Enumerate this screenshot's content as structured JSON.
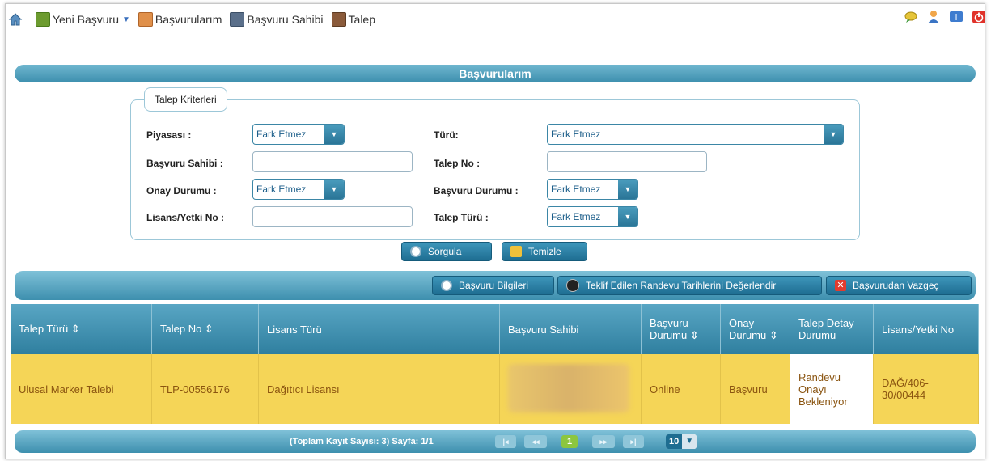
{
  "nav": {
    "new_application": "Yeni Başvuru",
    "my_applications": "Başvurularım",
    "applicant": "Başvuru Sahibi",
    "request": "Talep"
  },
  "header_title": "Başvurularım",
  "criteria": {
    "legend": "Talep Kriterleri",
    "market_label": "Piyasası :",
    "market_value": "Fark Etmez",
    "type_label": "Türü:",
    "type_value": "Fark Etmez",
    "applicant_label": "Başvuru Sahibi :",
    "request_no_label": "Talep No :",
    "approval_status_label": "Onay Durumu :",
    "approval_status_value": "Fark Etmez",
    "application_status_label": "Başvuru Durumu :",
    "application_status_value": "Fark Etmez",
    "license_no_label": "Lisans/Yetki No :",
    "request_type_label": "Talep Türü :",
    "request_type_value": "Fark Etmez"
  },
  "buttons": {
    "query": "Sorgula",
    "clear": "Temizle",
    "app_info": "Başvuru Bilgileri",
    "evaluate_dates": "Teklif Edilen Randevu Tarihlerini Değerlendir",
    "withdraw": "Başvurudan Vazgeç"
  },
  "table": {
    "headers": [
      "Talep Türü ⇕",
      "Talep No ⇕",
      "Lisans Türü",
      "Başvuru Sahibi",
      "Başvuru Durumu ⇕",
      "Onay Durumu ⇕",
      "Talep Detay Durumu",
      "Lisans/Yetki No"
    ],
    "row": {
      "request_type": "Ulusal Marker Talebi",
      "request_no": "TLP-00556176",
      "license_type": "Dağıtıcı Lisansı",
      "application_status": "Online",
      "approval_status": "Başvuru",
      "detail_status": "Randevu Onayı Bekleniyor",
      "license_no": "DAĞ/406-30/00444"
    }
  },
  "pager": {
    "summary": "(Toplam Kayıt Sayısı: 3) Sayfa: 1/1",
    "first": "|◂",
    "prev": "◂◂",
    "current": "1",
    "next": "▸▸",
    "last": "▸|",
    "page_size": "10"
  },
  "colors": {
    "accent": "#3d8fae",
    "row_highlight": "#f5d557",
    "text_brown": "#8a5410"
  }
}
